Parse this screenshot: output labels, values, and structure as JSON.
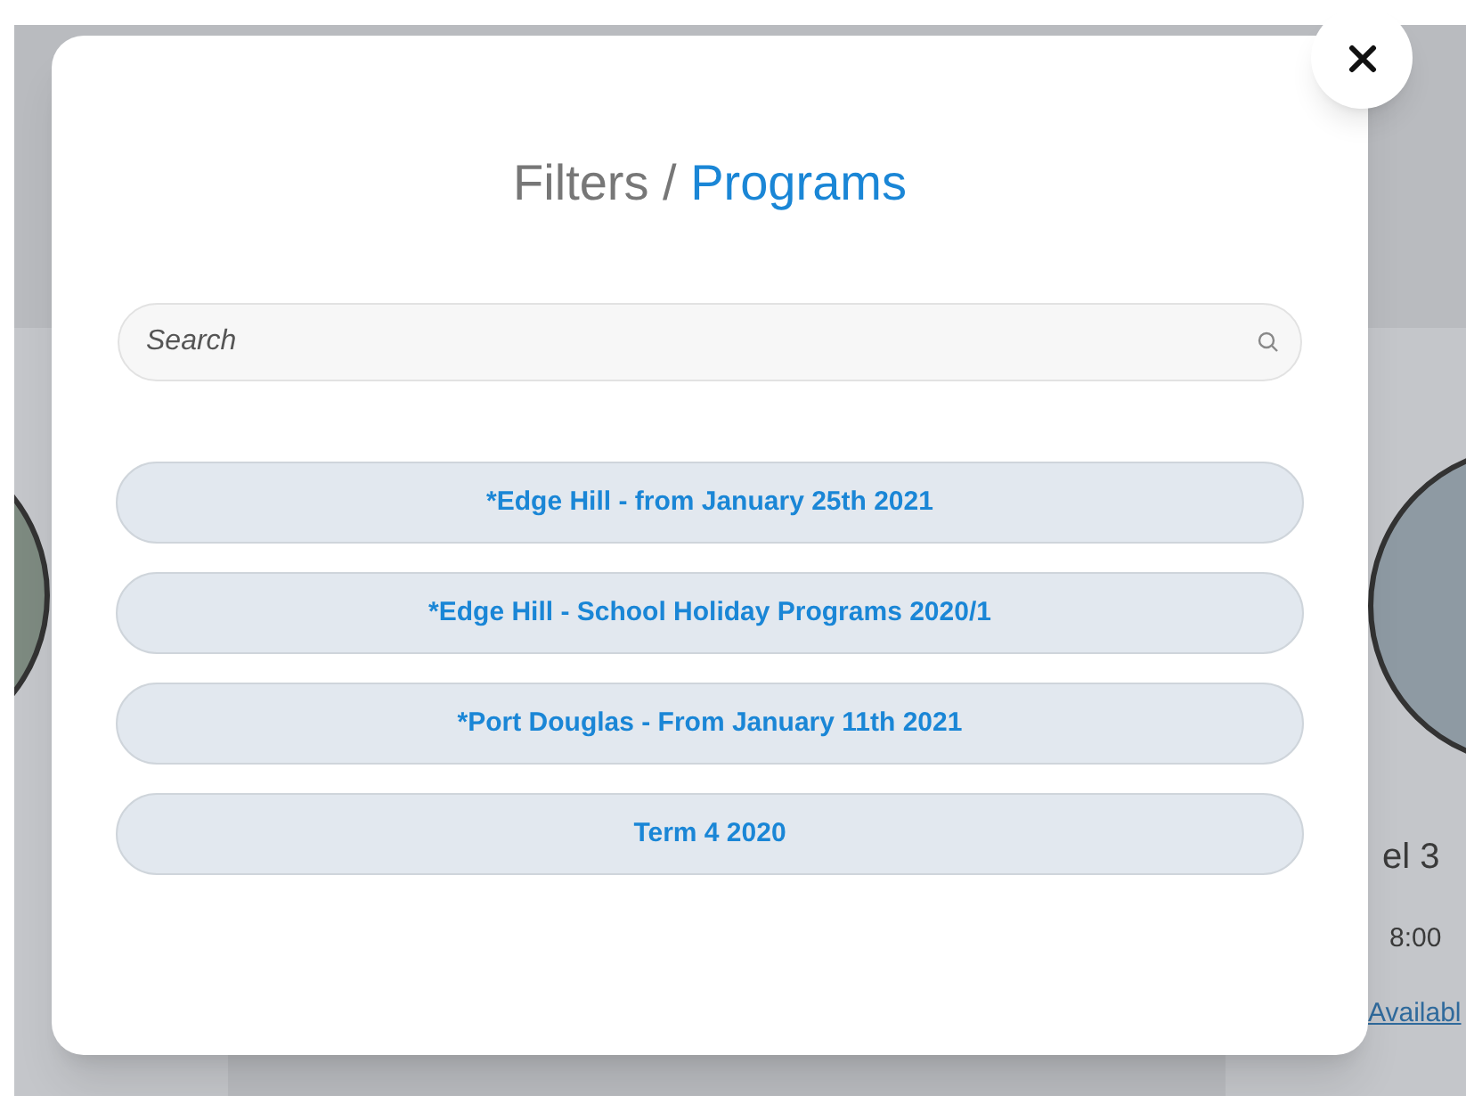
{
  "background": {
    "card_title": "el 3",
    "time": "8:00",
    "link": "Availabl"
  },
  "dialog": {
    "title_prefix": "Filters /",
    "title_current": "Programs",
    "search": {
      "placeholder": "Search"
    },
    "programs": [
      {
        "label": "*Edge Hill - from January 25th 2021"
      },
      {
        "label": "*Edge Hill - School Holiday Programs 2020/1"
      },
      {
        "label": "*Port Douglas - From January 11th 2021"
      },
      {
        "label": "Term 4 2020"
      }
    ]
  }
}
